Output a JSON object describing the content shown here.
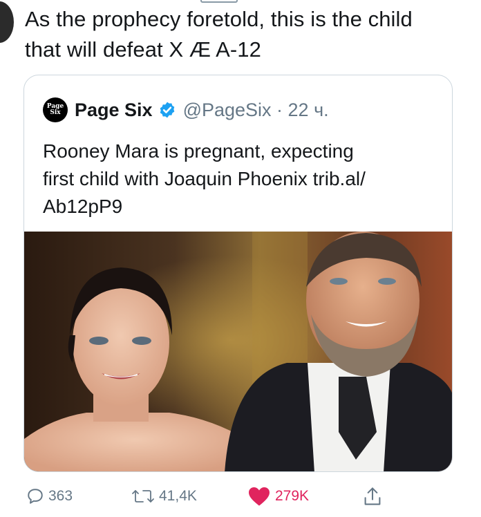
{
  "tweet": {
    "text_line1": "As the prophecy foretold, this is the child",
    "text_line2": "that will defeat X Æ A-12"
  },
  "quoted": {
    "logo_line1": "Page",
    "logo_line2": "Six",
    "name": "Page Six",
    "handle_time": "@PageSix · 22 ч.",
    "text_line1": "Rooney Mara is pregnant, expecting",
    "text_line2": "first child with Joaquin Phoenix trib.al/",
    "text_line3": "Ab12pP9",
    "image_icon": "photo-of-two-people"
  },
  "actions": {
    "reply_icon": "reply-icon",
    "reply_count": "363",
    "retweet_icon": "retweet-icon",
    "retweet_count": "41,4K",
    "like_icon": "heart-icon",
    "like_count": "279K",
    "share_icon": "share-icon"
  },
  "colors": {
    "text": "#14171a",
    "muted": "#657786",
    "border": "#ccd6dd",
    "verified": "#1da1f2",
    "like": "#e0245e"
  }
}
